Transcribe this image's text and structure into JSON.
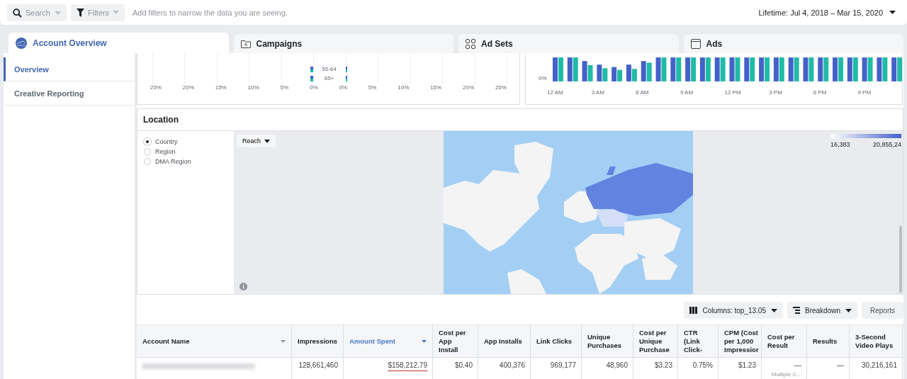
{
  "toolbar": {
    "search": {
      "placeholder": "Search"
    },
    "filters": {
      "label": "Filters"
    },
    "hint": "Add filters to narrow the data you are seeing.",
    "date_range": "Lifetime: Jul 4, 2018 – Mar 15, 2020"
  },
  "tabs": [
    {
      "label": "Account Overview",
      "selected": true,
      "kind": "overview"
    },
    {
      "label": "Campaigns",
      "selected": false,
      "kind": "campaigns"
    },
    {
      "label": "Ad Sets",
      "selected": false,
      "kind": "adsets"
    },
    {
      "label": "Ads",
      "selected": false,
      "kind": "ads"
    }
  ],
  "sidebar": {
    "items": [
      {
        "label": "Overview",
        "selected": true
      },
      {
        "label": "Creative Reporting",
        "selected": false
      }
    ]
  },
  "age_chart": {
    "age_groups": [
      "55-64",
      "65+"
    ],
    "axis_labels": [
      "25%",
      "20%",
      "15%",
      "10%",
      "5%",
      "0%",
      "0%",
      "5%",
      "10%",
      "15%",
      "20%",
      "25%"
    ]
  },
  "hour_chart": {
    "y_label": "0%",
    "hours": [
      "12 AM",
      "3 AM",
      "6 AM",
      "9 AM",
      "12 PM",
      "3 PM",
      "6 PM",
      "9 PM"
    ]
  },
  "location": {
    "title": "Location",
    "options": [
      {
        "label": "Country",
        "selected": true
      },
      {
        "label": "Region",
        "selected": false
      },
      {
        "label": "DMA Region",
        "selected": false
      }
    ],
    "metric_button": "Reach",
    "legend": {
      "min": "16,383",
      "max": "20,855,24"
    }
  },
  "table_toolbar": {
    "columns_button": "Columns: top_13.05",
    "breakdown_button": "Breakdown",
    "reports_button": "Reports"
  },
  "table": {
    "columns": [
      {
        "label": "Account Name",
        "sorted": false,
        "has_menu": true
      },
      {
        "label": "Impressions",
        "sorted": false,
        "has_menu": false
      },
      {
        "label": "Amount Spent",
        "sorted": true,
        "has_menu": true
      },
      {
        "label": "Cost per App Install",
        "sorted": false,
        "has_menu": false
      },
      {
        "label": "App Installs",
        "sorted": false,
        "has_menu": false
      },
      {
        "label": "Link Clicks",
        "sorted": false,
        "has_menu": false
      },
      {
        "label": "Unique Purchases",
        "sorted": false,
        "has_menu": false
      },
      {
        "label": "Cost per Unique Purchase",
        "sorted": false,
        "has_menu": false
      },
      {
        "label": "CTR (Link Click-",
        "sorted": false,
        "has_menu": false
      },
      {
        "label": "CPM (Cost per 1,000 Impressior",
        "sorted": false,
        "has_menu": false
      },
      {
        "label": "Cost per Result",
        "sorted": false,
        "has_menu": false
      },
      {
        "label": "Results",
        "sorted": false,
        "has_menu": false
      },
      {
        "label": "3-Second Video Plays",
        "sorted": false,
        "has_menu": false
      }
    ],
    "rows": [
      {
        "cells": [
          {
            "kind": "redacted"
          },
          {
            "kind": "text",
            "text": "128,661,460",
            "underlined": false
          },
          {
            "kind": "text",
            "text": "$158,212.79",
            "underlined": true
          },
          {
            "kind": "text",
            "text": "$0.40",
            "underlined": false
          },
          {
            "kind": "text",
            "text": "400,376",
            "underlined": false
          },
          {
            "kind": "text",
            "text": "969,177",
            "underlined": false
          },
          {
            "kind": "text",
            "text": "48,960",
            "underlined": false
          },
          {
            "kind": "text",
            "text": "$3.23",
            "underlined": false
          },
          {
            "kind": "text",
            "text": "0.75%",
            "underlined": false
          },
          {
            "kind": "text",
            "text": "$1.23",
            "underlined": false
          },
          {
            "kind": "text",
            "text": "—",
            "underlined": false,
            "note": "Multiple C..."
          },
          {
            "kind": "text",
            "text": "—",
            "underlined": false
          },
          {
            "kind": "text",
            "text": "30,216,161",
            "underlined": false
          }
        ]
      }
    ]
  }
}
